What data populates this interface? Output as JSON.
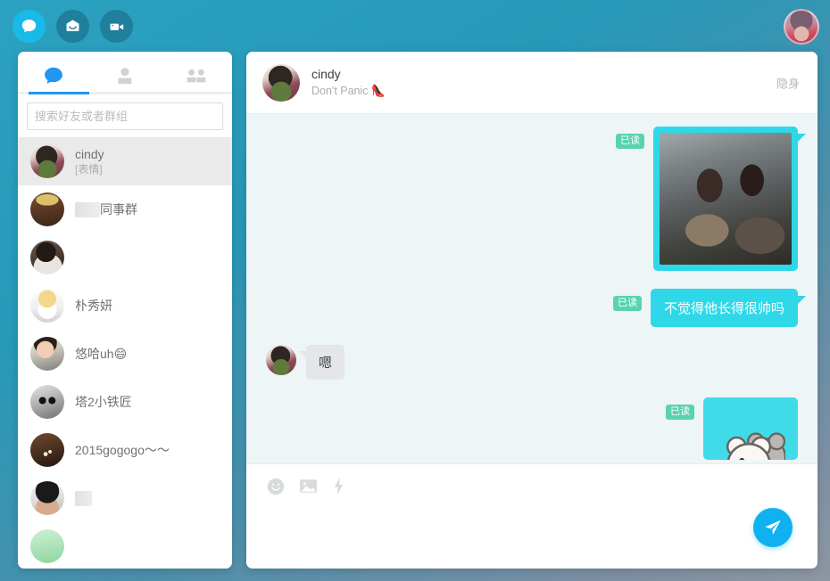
{
  "app": {
    "accent_blue": "#18bbe8",
    "send_blue": "#10b1f0",
    "bubble_out": "#2fd8e8",
    "bubble_in": "#e4e6e8",
    "read_badge_green": "#58d3ae",
    "background_top": "#2799b8",
    "background_bottom": "#7d8fa3"
  },
  "topbar": {
    "icons": [
      {
        "name": "chat-icon",
        "label": "消息",
        "active": true
      },
      {
        "name": "mail-icon",
        "label": "邮件",
        "active": false
      },
      {
        "name": "video-icon",
        "label": "视频",
        "active": false
      }
    ],
    "profile_avatar_label": "我的头像"
  },
  "sidebar": {
    "tabs": [
      {
        "name": "tab-chats",
        "label": "消息",
        "active": true
      },
      {
        "name": "tab-contacts",
        "label": "联系人",
        "active": false
      },
      {
        "name": "tab-groups",
        "label": "群组",
        "active": false
      }
    ],
    "search": {
      "placeholder": "搜索好友或者群组",
      "value": ""
    },
    "contacts": [
      {
        "name": "cindy",
        "sub": "[表情]",
        "selected": true
      },
      {
        "name": "同事群",
        "redacted_prefix": true,
        "sub": "",
        "selected": false
      },
      {
        "name": "",
        "sub": "",
        "selected": false
      },
      {
        "name": "朴秀妍",
        "sub": "",
        "selected": false
      },
      {
        "name": "悠哈uh😄",
        "sub": "",
        "selected": false
      },
      {
        "name": "塔2小铁匠",
        "sub": "",
        "selected": false
      },
      {
        "name": "2015gogogo〜〜",
        "sub": "",
        "selected": false
      },
      {
        "name": "",
        "sub": "",
        "selected": false
      }
    ]
  },
  "chat": {
    "header": {
      "name": "cindy",
      "signature": "Don't Panic",
      "signature_emoji": "👠",
      "status_action": "隐身"
    },
    "messages": [
      {
        "id": "m1",
        "direction": "out",
        "type": "image",
        "read_label": "已读",
        "alt": "两人在影院喝饮料的照片"
      },
      {
        "id": "m2",
        "direction": "out",
        "type": "text",
        "read_label": "已读",
        "text": "不觉得他长得很帅吗"
      },
      {
        "id": "m3",
        "direction": "in",
        "type": "text",
        "text": "嗯"
      },
      {
        "id": "m4",
        "direction": "out",
        "type": "sticker",
        "read_label": "已读",
        "alt": "小熊贴图"
      }
    ],
    "composer": {
      "tools": [
        {
          "name": "emoji-icon",
          "label": "表情"
        },
        {
          "name": "image-icon",
          "label": "图片"
        },
        {
          "name": "lightning-icon",
          "label": "快捷"
        }
      ],
      "input_value": "",
      "input_placeholder": "",
      "send_label": "发送"
    }
  }
}
